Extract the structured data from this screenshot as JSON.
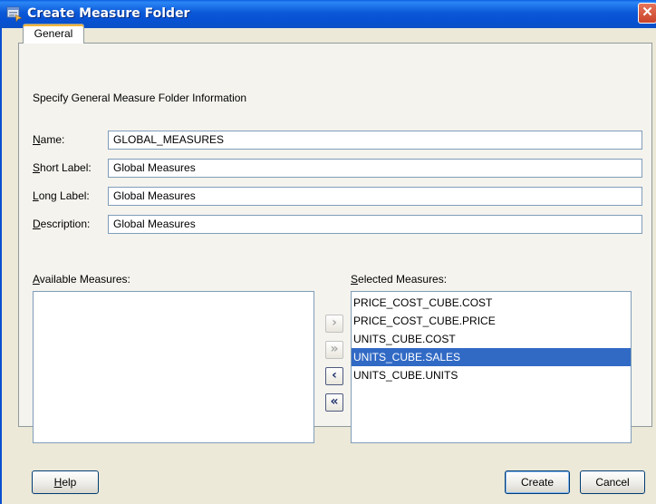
{
  "window": {
    "title": "Create Measure Folder",
    "close_glyph": "✕"
  },
  "tabs": [
    {
      "label": "General"
    }
  ],
  "form": {
    "intro": "Specify General Measure Folder Information",
    "fields": [
      {
        "label_first": "N",
        "label_rest": "ame:",
        "value": "GLOBAL_MEASURES"
      },
      {
        "label_first": "S",
        "label_rest": "hort Label:",
        "value": "Global Measures"
      },
      {
        "label_first": "L",
        "label_rest": "ong Label:",
        "value": "Global Measures"
      },
      {
        "label_first": "D",
        "label_rest": "escription:",
        "value": "Global Measures"
      }
    ]
  },
  "available": {
    "label_first": "A",
    "label_rest": "vailable Measures:",
    "items": []
  },
  "selected": {
    "label_first": "S",
    "label_rest": "elected Measures:",
    "items": [
      {
        "text": "PRICE_COST_CUBE.COST",
        "selected": false
      },
      {
        "text": "PRICE_COST_CUBE.PRICE",
        "selected": false
      },
      {
        "text": "UNITS_CUBE.COST",
        "selected": false
      },
      {
        "text": "UNITS_CUBE.SALES",
        "selected": true
      },
      {
        "text": "UNITS_CUBE.UNITS",
        "selected": false
      }
    ]
  },
  "shuttle": {
    "move_right": {
      "glyph": "›",
      "icon": "chevron-right-icon",
      "enabled": false
    },
    "move_all_right": {
      "glyph": "»",
      "icon": "double-chevron-right-icon",
      "enabled": false
    },
    "move_left": {
      "glyph": "‹",
      "icon": "chevron-left-icon",
      "enabled": true
    },
    "move_all_left": {
      "glyph": "«",
      "icon": "double-chevron-left-icon",
      "enabled": true
    }
  },
  "buttons": {
    "help_first": "H",
    "help_rest": "elp",
    "create": "Create",
    "cancel": "Cancel"
  },
  "colors": {
    "title_bar": "#0a5fe0",
    "selection": "#316ac5",
    "close": "#c9432a"
  }
}
